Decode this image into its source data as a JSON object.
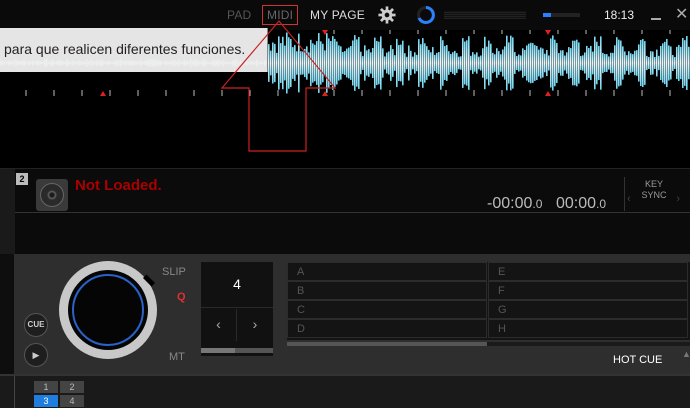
{
  "topbar": {
    "nav": [
      "PAD",
      "MIDI",
      "MY PAGE"
    ],
    "clock": "18:13",
    "volume_level": 0.22,
    "icons": [
      "gear-icon",
      "loading-spinner-icon",
      "minimize-icon",
      "close-icon"
    ]
  },
  "tooltip": {
    "text": "para que realicen diferentes funciones."
  },
  "deck": {
    "number": "2",
    "status": "Not Loaded.",
    "time_remain_main": "-00:00",
    "time_remain_frac": ".0",
    "time_elapsed_main": "00:00",
    "time_elapsed_frac": ".0",
    "keysync": "KEY SYNC",
    "ks_left": "‹",
    "ks_right": "›"
  },
  "controls": {
    "cue": "CUE",
    "play": "▶",
    "slip": "SLIP",
    "q": "Q",
    "mt": "MT",
    "loop_value": "4",
    "loop_prev": "‹",
    "loop_next": "›",
    "pads": [
      "A",
      "B",
      "C",
      "D",
      "E",
      "F",
      "G",
      "H"
    ],
    "pad_mode": "HOT CUE",
    "pad_mode_arrows": "▲▼"
  },
  "deck_selector": {
    "items": [
      "1",
      "2",
      "3",
      "4"
    ],
    "active": "3"
  },
  "colors": {
    "accent_blue": "#2a62c9",
    "status_red": "#a00000",
    "q_red": "#e03030",
    "waveform_cyan": "#79e4ff",
    "cue_marker_red": "#e02020"
  }
}
